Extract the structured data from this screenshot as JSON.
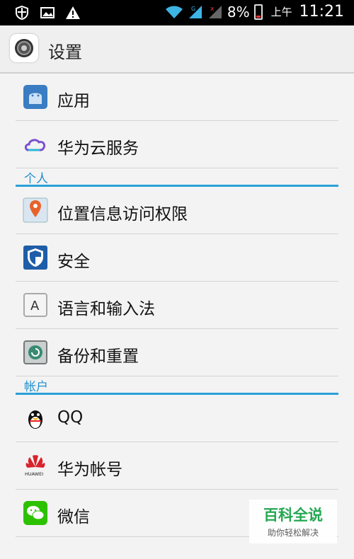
{
  "status_bar": {
    "battery_percent": "8%",
    "ampm": "上午",
    "time": "11:21",
    "left_icons": [
      "shield-icon",
      "image-icon",
      "warning-icon"
    ],
    "right_icons": [
      "wifi-icon",
      "signal-icon",
      "signal-off-icon",
      "battery-icon"
    ]
  },
  "header": {
    "title": "设置",
    "icon": "settings-gear-icon"
  },
  "list": {
    "row_app": "应用",
    "row_cloud": "华为云服务",
    "section_personal": "个人",
    "row_location": "位置信息访问权限",
    "row_security": "安全",
    "row_language": "语言和输入法",
    "row_backup": "备份和重置",
    "section_accounts": "帐户",
    "row_qq": "QQ",
    "row_huawei": "华为帐号",
    "row_wechat": "微信"
  },
  "watermark": {
    "title": "百科全说",
    "subtitle": "助你轻松解决"
  },
  "colors": {
    "accent": "#2aa0d8",
    "background": "#f3f3f3"
  }
}
